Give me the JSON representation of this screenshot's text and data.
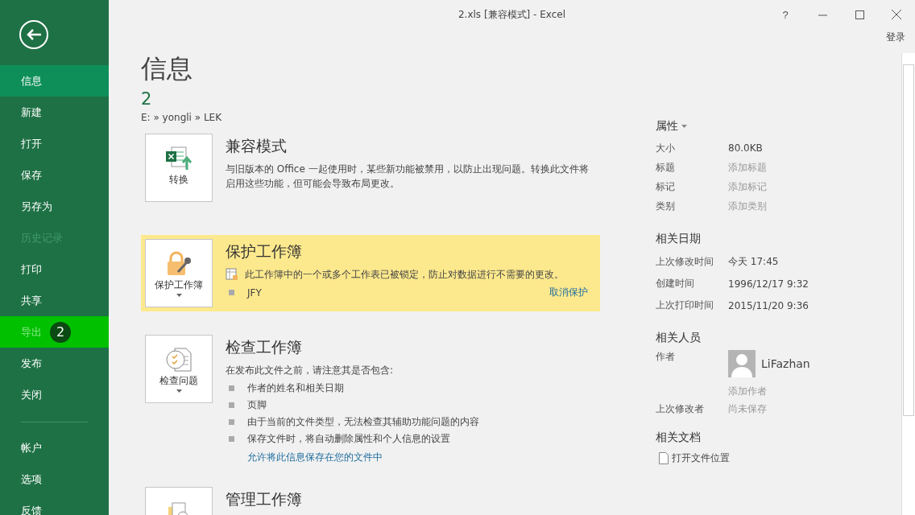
{
  "window": {
    "title": "2.xls  [兼容模式] - Excel",
    "help": "?",
    "sign_in": "登录"
  },
  "sidebar": {
    "items": [
      {
        "label": "信息",
        "selected": true,
        "disabled": false,
        "highlighted": false
      },
      {
        "label": "新建",
        "selected": false,
        "disabled": false,
        "highlighted": false
      },
      {
        "label": "打开",
        "selected": false,
        "disabled": false,
        "highlighted": false
      },
      {
        "label": "保存",
        "selected": false,
        "disabled": false,
        "highlighted": false
      },
      {
        "label": "另存为",
        "selected": false,
        "disabled": false,
        "highlighted": false
      },
      {
        "label": "历史记录",
        "selected": false,
        "disabled": true,
        "highlighted": false
      },
      {
        "label": "打印",
        "selected": false,
        "disabled": false,
        "highlighted": false
      },
      {
        "label": "共享",
        "selected": false,
        "disabled": false,
        "highlighted": false
      },
      {
        "label": "导出",
        "selected": false,
        "disabled": false,
        "highlighted": true,
        "badge": "2"
      },
      {
        "label": "发布",
        "selected": false,
        "disabled": false,
        "highlighted": false
      },
      {
        "label": "关闭",
        "selected": false,
        "disabled": false,
        "highlighted": false
      }
    ],
    "bottom_items": [
      {
        "label": "帐户",
        "selected": false,
        "disabled": false,
        "highlighted": false
      },
      {
        "label": "选项",
        "selected": false,
        "disabled": false,
        "highlighted": false
      },
      {
        "label": "反馈",
        "selected": false,
        "disabled": false,
        "highlighted": false
      }
    ]
  },
  "info": {
    "heading": "信息",
    "file_name": "2",
    "path": "E: » yongli » LEK",
    "sections": [
      {
        "kind": "convert",
        "button": "转换",
        "dropdown": false,
        "highlighted": false,
        "title": "兼容模式",
        "description": "与旧版本的 Office 一起使用时，某些新功能被禁用，以防止出现问题。转换此文件将启用这些功能，但可能会导致布局更改。"
      },
      {
        "kind": "protect",
        "button": "保护工作簿",
        "dropdown": true,
        "highlighted": true,
        "title": "保护工作簿",
        "description": "此工作簿中的一个或多个工作表已被锁定，防止对数据进行不需要的更改。",
        "bullets": [
          "JFY"
        ],
        "side_link": "取消保护"
      },
      {
        "kind": "inspect",
        "button": "检查问题",
        "dropdown": true,
        "highlighted": false,
        "title": "检查工作簿",
        "description": "在发布此文件之前，请注意其是否包含:",
        "bullets": [
          "作者的姓名和相关日期",
          "页脚",
          "由于当前的文件类型，无法检查其辅助功能问题的内容",
          "保存文件时，将自动删除属性和个人信息的设置"
        ],
        "link": "允许将此信息保存在您的文件中"
      },
      {
        "kind": "manage",
        "highlighted": false,
        "title": "管理工作簿"
      }
    ]
  },
  "properties": {
    "title": "属性",
    "rows": [
      {
        "label": "大小",
        "value": "80.0KB"
      },
      {
        "label": "标题",
        "placeholder": "添加标题"
      },
      {
        "label": "标记",
        "placeholder": "添加标记"
      },
      {
        "label": "类别",
        "placeholder": "添加类别"
      }
    ],
    "dates_title": "相关日期",
    "dates": [
      {
        "label": "上次修改时间",
        "value": "今天 17:45"
      },
      {
        "label": "创建时间",
        "value": "1996/12/17 9:32"
      },
      {
        "label": "上次打印时间",
        "value": "2015/11/20 9:36"
      }
    ],
    "people_title": "相关人员",
    "author_label": "作者",
    "author": "LiFazhan",
    "add_author": {
      "placeholder": "添加作者"
    },
    "modified_by_label": "上次修改者",
    "modified_by": "尚未保存",
    "docs_title": "相关文档",
    "open_location": "打开文件位置"
  }
}
